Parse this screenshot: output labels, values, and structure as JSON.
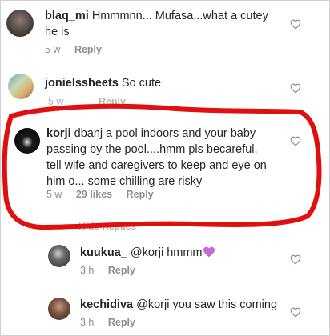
{
  "comments": [
    {
      "username": "blaq_mi",
      "text": "Hmmmnn... Mufasa...what a cutey he is",
      "line1": "Hmmmnn... Mufasa...what a cutey",
      "line2": "he is",
      "time": "5 w",
      "reply": "Reply"
    },
    {
      "username": "jonielssheets",
      "text": "So cute",
      "time": "5 w",
      "reply": "Reply"
    },
    {
      "username": "korji",
      "line1": "dbanj a pool indoors and your baby",
      "line2": "passing by the pool....hmm pls becareful,",
      "line3": "tell wife and caregivers to keep and eye on",
      "line4": "him o... some chilling are risky",
      "time": "5 w",
      "likes": "29 likes",
      "reply": "Reply"
    },
    {
      "username": "kuukua_",
      "text": "@korji hmmm",
      "time": "3 h",
      "reply": "Reply"
    },
    {
      "username": "kechidiva",
      "text": "@korji you saw this coming",
      "time": "3 h",
      "reply": "Reply"
    }
  ],
  "hide_replies": "Hide Replies",
  "icons": {
    "like": "heart-outline-icon",
    "emoji": "purple-heart-emoji"
  },
  "colors": {
    "annotation": "#e01010",
    "meta": "#8e8e8e",
    "emoji": "#c86ad6"
  }
}
